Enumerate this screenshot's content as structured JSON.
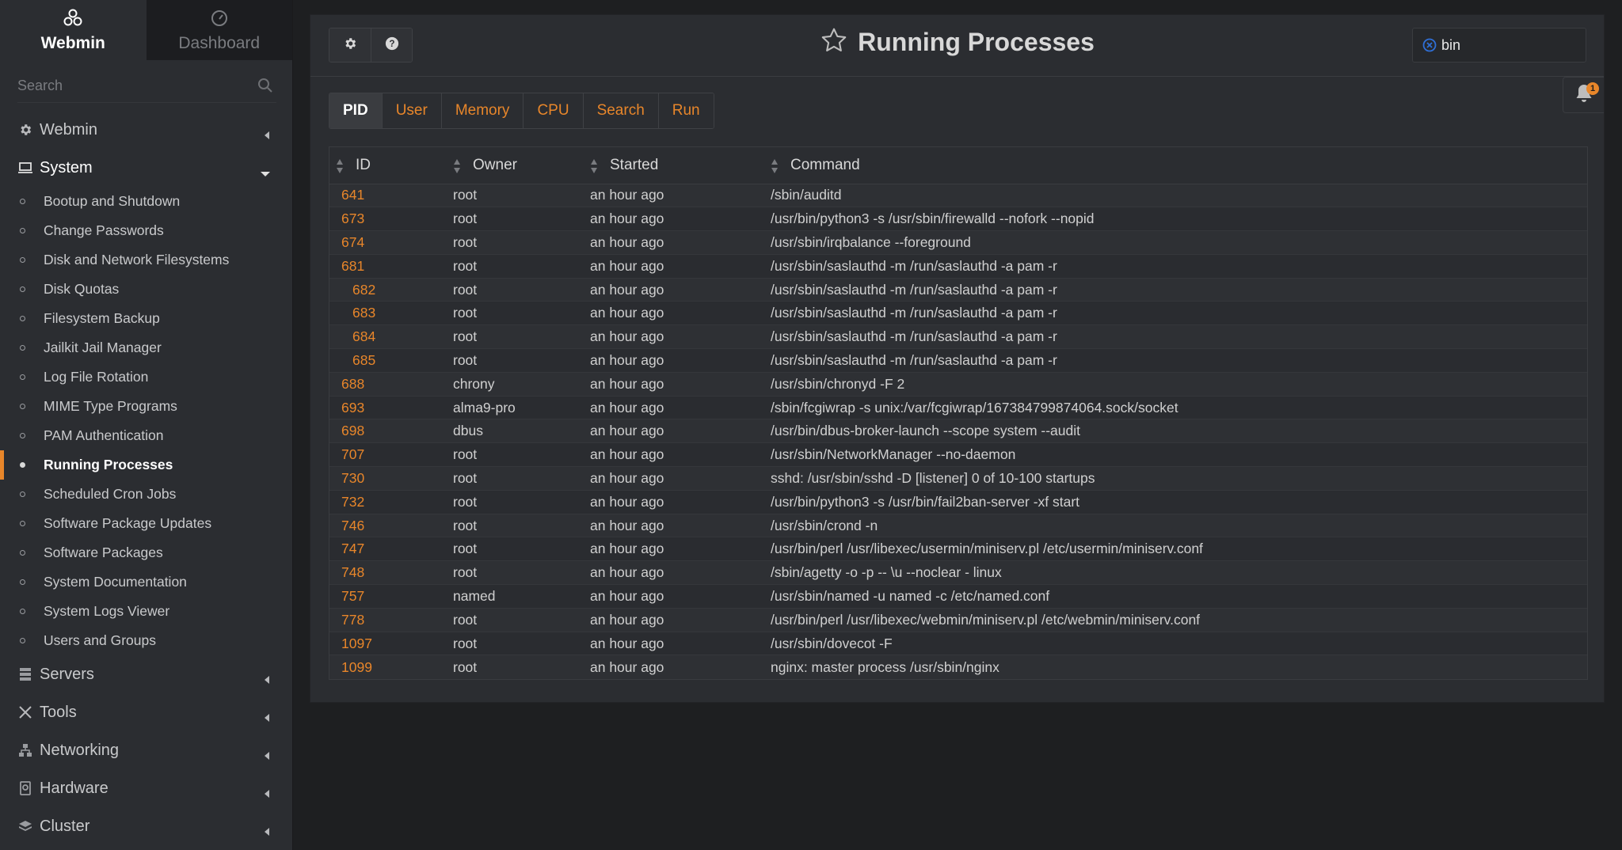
{
  "brand": {
    "webmin_label": "Webmin",
    "dashboard_label": "Dashboard"
  },
  "sidebar": {
    "search_placeholder": "Search",
    "categories_top": [
      {
        "label": "Webmin",
        "icon": "gear-icon"
      },
      {
        "label": "System",
        "icon": "laptop-icon"
      }
    ],
    "system_items": [
      {
        "label": "Bootup and Shutdown"
      },
      {
        "label": "Change Passwords"
      },
      {
        "label": "Disk and Network Filesystems"
      },
      {
        "label": "Disk Quotas"
      },
      {
        "label": "Filesystem Backup"
      },
      {
        "label": "Jailkit Jail Manager"
      },
      {
        "label": "Log File Rotation"
      },
      {
        "label": "MIME Type Programs"
      },
      {
        "label": "PAM Authentication"
      },
      {
        "label": "Running Processes"
      },
      {
        "label": "Scheduled Cron Jobs"
      },
      {
        "label": "Software Package Updates"
      },
      {
        "label": "Software Packages"
      },
      {
        "label": "System Documentation"
      },
      {
        "label": "System Logs Viewer"
      },
      {
        "label": "Users and Groups"
      }
    ],
    "active_item": "Running Processes",
    "categories_bottom": [
      {
        "label": "Servers",
        "icon": "server-icon"
      },
      {
        "label": "Tools",
        "icon": "tools-icon"
      },
      {
        "label": "Networking",
        "icon": "network-icon"
      },
      {
        "label": "Hardware",
        "icon": "hardware-icon"
      },
      {
        "label": "Cluster",
        "icon": "layers-icon"
      }
    ]
  },
  "header": {
    "title": "Running Processes",
    "filter_value": "bin",
    "notification_count": "1"
  },
  "tabs": [
    {
      "label": "PID",
      "active": true
    },
    {
      "label": "User",
      "active": false
    },
    {
      "label": "Memory",
      "active": false
    },
    {
      "label": "CPU",
      "active": false
    },
    {
      "label": "Search",
      "active": false
    },
    {
      "label": "Run",
      "active": false
    }
  ],
  "table": {
    "columns": [
      "ID",
      "Owner",
      "Started",
      "Command"
    ],
    "rows": [
      {
        "id": "641",
        "child": false,
        "owner": "root",
        "started": "an hour ago",
        "command": "/sbin/auditd"
      },
      {
        "id": "673",
        "child": false,
        "owner": "root",
        "started": "an hour ago",
        "command": "/usr/bin/python3 -s /usr/sbin/firewalld --nofork --nopid"
      },
      {
        "id": "674",
        "child": false,
        "owner": "root",
        "started": "an hour ago",
        "command": "/usr/sbin/irqbalance --foreground"
      },
      {
        "id": "681",
        "child": false,
        "owner": "root",
        "started": "an hour ago",
        "command": "/usr/sbin/saslauthd -m /run/saslauthd -a pam -r"
      },
      {
        "id": "682",
        "child": true,
        "owner": "root",
        "started": "an hour ago",
        "command": "/usr/sbin/saslauthd -m /run/saslauthd -a pam -r"
      },
      {
        "id": "683",
        "child": true,
        "owner": "root",
        "started": "an hour ago",
        "command": "/usr/sbin/saslauthd -m /run/saslauthd -a pam -r"
      },
      {
        "id": "684",
        "child": true,
        "owner": "root",
        "started": "an hour ago",
        "command": "/usr/sbin/saslauthd -m /run/saslauthd -a pam -r"
      },
      {
        "id": "685",
        "child": true,
        "owner": "root",
        "started": "an hour ago",
        "command": "/usr/sbin/saslauthd -m /run/saslauthd -a pam -r"
      },
      {
        "id": "688",
        "child": false,
        "owner": "chrony",
        "started": "an hour ago",
        "command": "/usr/sbin/chronyd -F 2"
      },
      {
        "id": "693",
        "child": false,
        "owner": "alma9-pro",
        "started": "an hour ago",
        "command": "/sbin/fcgiwrap -s unix:/var/fcgiwrap/167384799874064.sock/socket"
      },
      {
        "id": "698",
        "child": false,
        "owner": "dbus",
        "started": "an hour ago",
        "command": "/usr/bin/dbus-broker-launch --scope system --audit"
      },
      {
        "id": "707",
        "child": false,
        "owner": "root",
        "started": "an hour ago",
        "command": "/usr/sbin/NetworkManager --no-daemon"
      },
      {
        "id": "730",
        "child": false,
        "owner": "root",
        "started": "an hour ago",
        "command": "sshd: /usr/sbin/sshd -D [listener] 0 of 10-100 startups"
      },
      {
        "id": "732",
        "child": false,
        "owner": "root",
        "started": "an hour ago",
        "command": "/usr/bin/python3 -s /usr/bin/fail2ban-server -xf start"
      },
      {
        "id": "746",
        "child": false,
        "owner": "root",
        "started": "an hour ago",
        "command": "/usr/sbin/crond -n"
      },
      {
        "id": "747",
        "child": false,
        "owner": "root",
        "started": "an hour ago",
        "command": "/usr/bin/perl /usr/libexec/usermin/miniserv.pl /etc/usermin/miniserv.conf"
      },
      {
        "id": "748",
        "child": false,
        "owner": "root",
        "started": "an hour ago",
        "command": "/sbin/agetty -o -p -- \\u --noclear - linux"
      },
      {
        "id": "757",
        "child": false,
        "owner": "named",
        "started": "an hour ago",
        "command": "/usr/sbin/named -u named -c /etc/named.conf"
      },
      {
        "id": "778",
        "child": false,
        "owner": "root",
        "started": "an hour ago",
        "command": "/usr/bin/perl /usr/libexec/webmin/miniserv.pl /etc/webmin/miniserv.conf"
      },
      {
        "id": "1097",
        "child": false,
        "owner": "root",
        "started": "an hour ago",
        "command": "/usr/sbin/dovecot -F"
      },
      {
        "id": "1099",
        "child": false,
        "owner": "root",
        "started": "an hour ago",
        "command": "nginx: master process /usr/sbin/nginx"
      }
    ]
  },
  "colors": {
    "accent": "#e8862a",
    "background": "#1e1f21",
    "panel": "#2b2d31",
    "filter_clear_icon": "#2f6fd6"
  }
}
